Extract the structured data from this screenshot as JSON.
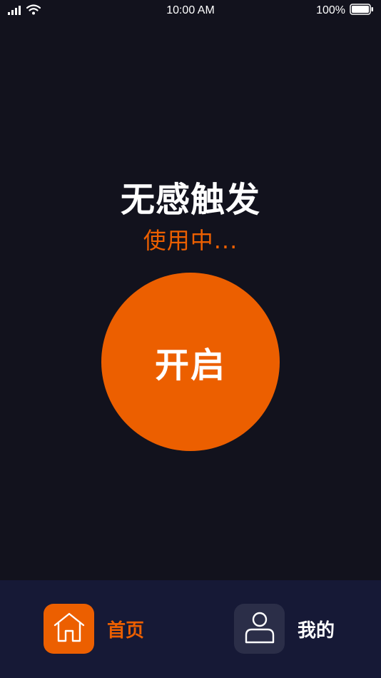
{
  "status_bar": {
    "time": "10:00 AM",
    "battery_percent": "100%",
    "icons": [
      "signal-icon",
      "wifi-icon",
      "battery-icon"
    ]
  },
  "main": {
    "title": "无感触发",
    "status": "使用中...",
    "toggle_label": "开启"
  },
  "tab_bar": {
    "home_label": "首页",
    "mine_label": "我的",
    "active_tab": "home"
  },
  "colors": {
    "accent": "#ec5f00",
    "background": "#12121d",
    "tab_bar": "#161936",
    "inactive_icon_bg": "#2b2e48",
    "text": "#ffffff"
  }
}
